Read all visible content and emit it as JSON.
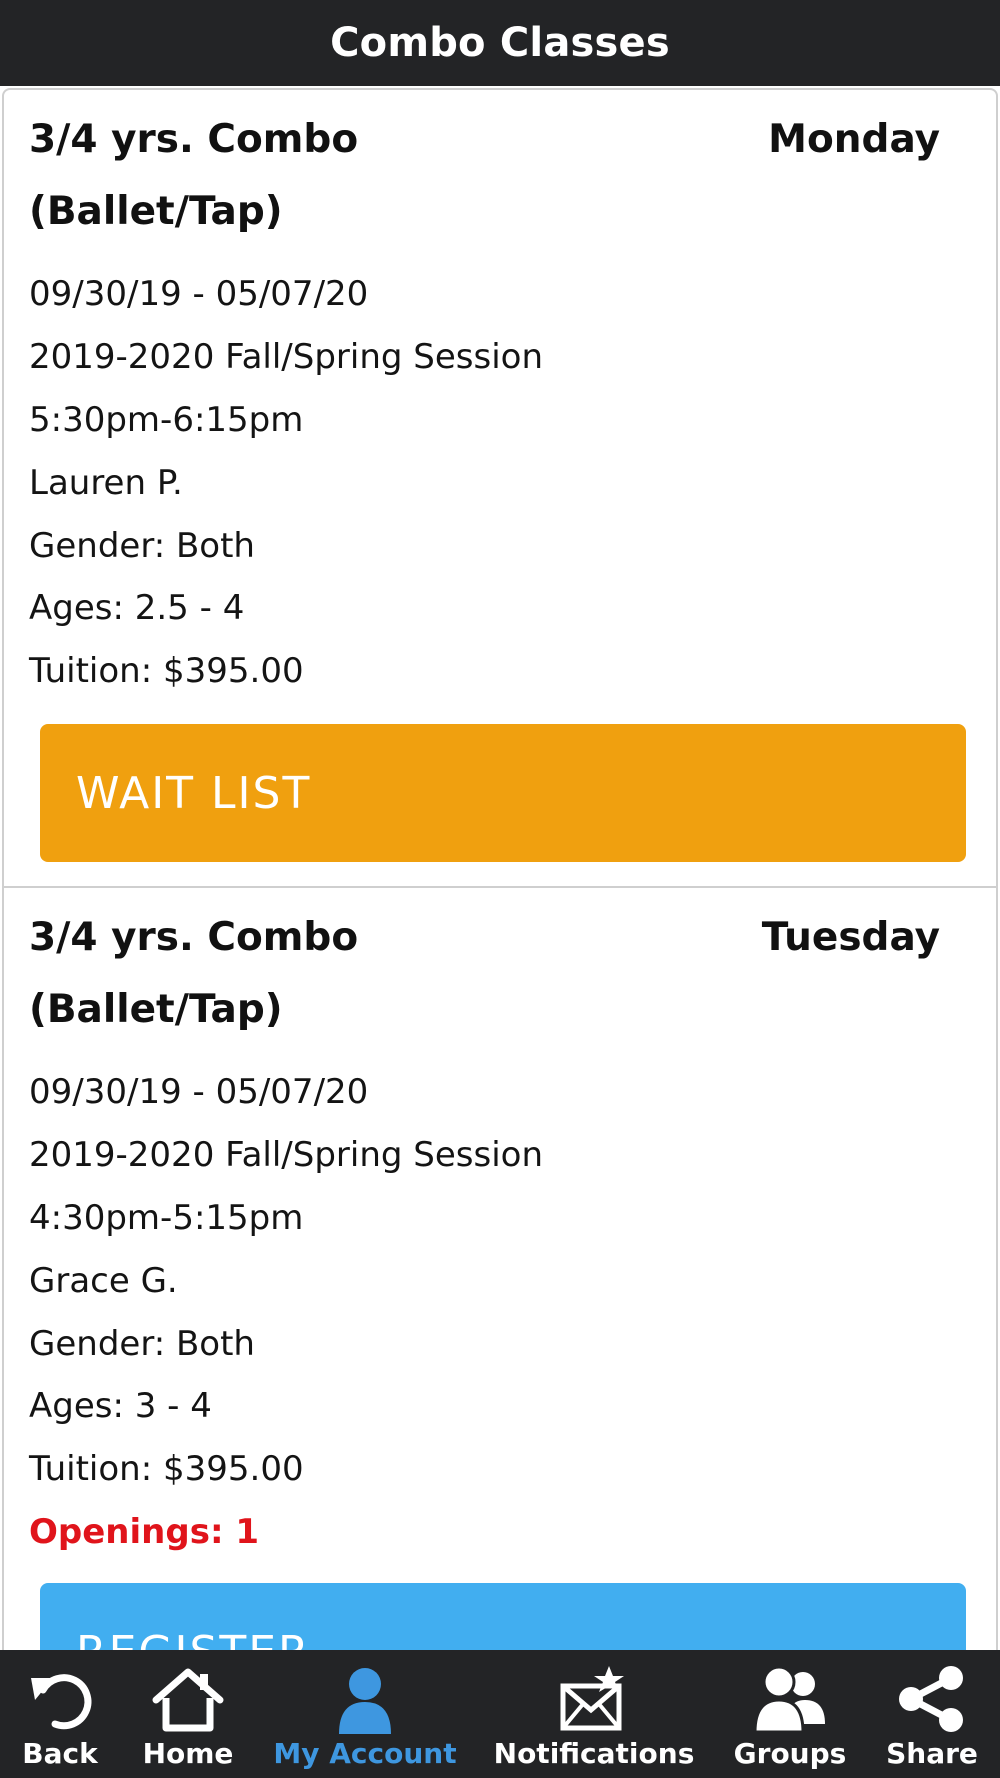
{
  "header": {
    "title": "Combo Classes"
  },
  "classes": [
    {
      "name_line1": "3/4 yrs. Combo",
      "name_line2": "(Ballet/Tap)",
      "day": "Monday",
      "dates": "09/30/19 - 05/07/20",
      "session": "2019-2020 Fall/Spring Session",
      "time": "5:30pm-6:15pm",
      "instructor": "Lauren P.",
      "gender": "Gender: Both",
      "ages": "Ages: 2.5 - 4",
      "tuition": "Tuition: $395.00",
      "button_label": "WAIT LIST",
      "button_color": "#f0a00f"
    },
    {
      "name_line1": "3/4 yrs. Combo",
      "name_line2": "(Ballet/Tap)",
      "day": "Tuesday",
      "dates": "09/30/19 - 05/07/20",
      "session": "2019-2020 Fall/Spring Session",
      "time": "4:30pm-5:15pm",
      "instructor": "Grace G.",
      "gender": "Gender: Both",
      "ages": "Ages: 3 - 4",
      "tuition": "Tuition: $395.00",
      "openings": "Openings: 1",
      "button_label": "REGISTER",
      "button_color": "#41aef0"
    }
  ],
  "tabbar": {
    "items": [
      {
        "label": "Back",
        "icon": "back-arrow-icon"
      },
      {
        "label": "Home",
        "icon": "home-icon"
      },
      {
        "label": "My Account",
        "icon": "person-icon",
        "active": true
      },
      {
        "label": "Notifications",
        "icon": "envelope-star-icon"
      },
      {
        "label": "Groups",
        "icon": "groups-icon"
      },
      {
        "label": "Share",
        "icon": "share-icon"
      }
    ],
    "active_color": "#3e97e0"
  }
}
